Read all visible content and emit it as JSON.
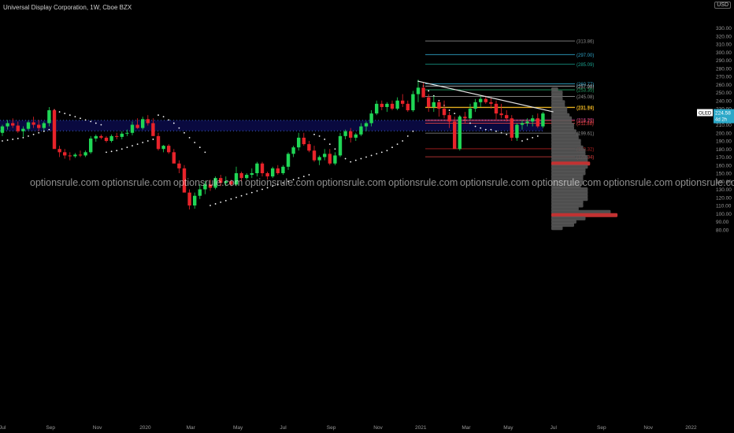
{
  "header": {
    "title": "Universal Display Corporation, 1W, Cboe BZX",
    "currency": "USD"
  },
  "ticker": {
    "symbol": "OLED",
    "price": "224.58",
    "countdown": "4d 2h"
  },
  "watermark": "optionsrule.com",
  "colors": {
    "up": "#1fd655",
    "down": "#e8232a",
    "sar": "#ffffff",
    "trendline": "#e6e6e6",
    "zone": "#0a0a4a",
    "axis_text": "#9a9a9a",
    "bg": "#000000",
    "volume_profile": "#5c5c5c",
    "poc": "#c23232"
  },
  "chart_data": {
    "type": "candlestick",
    "ylim": [
      80,
      320
    ],
    "y_ticks": [
      "330.00",
      "320.00",
      "310.00",
      "300.00",
      "290.00",
      "280.00",
      "270.00",
      "260.00",
      "250.00",
      "240.00",
      "230.00",
      "220.00",
      "210.00",
      "200.00",
      "190.00",
      "180.00",
      "170.00",
      "160.00",
      "150.00",
      "140.00",
      "130.00",
      "120.00",
      "110.00",
      "100.00",
      "90.00",
      "80.00"
    ],
    "x_labels": [
      {
        "label": "Jul",
        "week": 0
      },
      {
        "label": "Sep",
        "week": 9
      },
      {
        "label": "Nov",
        "week": 18
      },
      {
        "label": "2020",
        "week": 27
      },
      {
        "label": "Mar",
        "week": 36
      },
      {
        "label": "May",
        "week": 45
      },
      {
        "label": "Jul",
        "week": 54
      },
      {
        "label": "Sep",
        "week": 63
      },
      {
        "label": "Nov",
        "week": 72
      },
      {
        "label": "2021",
        "week": 80
      },
      {
        "label": "Mar",
        "week": 89
      },
      {
        "label": "May",
        "week": 97
      },
      {
        "label": "Jul",
        "week": 106
      },
      {
        "label": "Sep",
        "week": 115
      },
      {
        "label": "Nov",
        "week": 124
      },
      {
        "label": "2022",
        "week": 132
      }
    ],
    "candles": [
      [
        200,
        210,
        196,
        208
      ],
      [
        208,
        216,
        204,
        212
      ],
      [
        212,
        218,
        206,
        209
      ],
      [
        209,
        214,
        200,
        202
      ],
      [
        202,
        208,
        195,
        205
      ],
      [
        205,
        215,
        203,
        213
      ],
      [
        213,
        220,
        206,
        210
      ],
      [
        210,
        216,
        202,
        206
      ],
      [
        206,
        214,
        203,
        212
      ],
      [
        212,
        232,
        208,
        228
      ],
      [
        228,
        230,
        190,
        180
      ],
      [
        180,
        184,
        170,
        176
      ],
      [
        176,
        180,
        168,
        172
      ],
      [
        172,
        176,
        166,
        171
      ],
      [
        171,
        175,
        169,
        173
      ],
      [
        173,
        178,
        170,
        172
      ],
      [
        172,
        178,
        170,
        176
      ],
      [
        176,
        196,
        174,
        193
      ],
      [
        193,
        198,
        189,
        196
      ],
      [
        196,
        198,
        192,
        194
      ],
      [
        194,
        196,
        188,
        190
      ],
      [
        190,
        198,
        188,
        196
      ],
      [
        196,
        200,
        192,
        195
      ],
      [
        195,
        202,
        192,
        199
      ],
      [
        199,
        204,
        196,
        200
      ],
      [
        200,
        214,
        197,
        210
      ],
      [
        210,
        218,
        205,
        206
      ],
      [
        206,
        220,
        204,
        217
      ],
      [
        217,
        222,
        209,
        212
      ],
      [
        212,
        218,
        200,
        196
      ],
      [
        196,
        200,
        178,
        180
      ],
      [
        180,
        185,
        176,
        184
      ],
      [
        184,
        186,
        174,
        176
      ],
      [
        176,
        180,
        165,
        162
      ],
      [
        162,
        166,
        150,
        156
      ],
      [
        156,
        160,
        130,
        126
      ],
      [
        126,
        130,
        105,
        110
      ],
      [
        110,
        126,
        106,
        122
      ],
      [
        122,
        136,
        118,
        130
      ],
      [
        130,
        140,
        124,
        136
      ],
      [
        136,
        142,
        128,
        132
      ],
      [
        132,
        146,
        130,
        144
      ],
      [
        144,
        148,
        134,
        138
      ],
      [
        138,
        146,
        134,
        140
      ],
      [
        140,
        142,
        134,
        136
      ],
      [
        136,
        158,
        134,
        150
      ],
      [
        150,
        152,
        140,
        144
      ],
      [
        144,
        150,
        142,
        148
      ],
      [
        148,
        156,
        144,
        150
      ],
      [
        150,
        164,
        146,
        162
      ],
      [
        162,
        164,
        146,
        150
      ],
      [
        150,
        152,
        142,
        146
      ],
      [
        146,
        158,
        144,
        156
      ],
      [
        156,
        160,
        148,
        150
      ],
      [
        150,
        160,
        148,
        158
      ],
      [
        158,
        176,
        154,
        174
      ],
      [
        174,
        184,
        170,
        182
      ],
      [
        182,
        200,
        178,
        194
      ],
      [
        194,
        200,
        184,
        186
      ],
      [
        186,
        190,
        176,
        178
      ],
      [
        178,
        184,
        164,
        166
      ],
      [
        166,
        172,
        160,
        170
      ],
      [
        170,
        180,
        166,
        174
      ],
      [
        174,
        180,
        160,
        162
      ],
      [
        162,
        176,
        160,
        172
      ],
      [
        172,
        200,
        170,
        196
      ],
      [
        196,
        204,
        192,
        202
      ],
      [
        202,
        206,
        188,
        194
      ],
      [
        194,
        200,
        190,
        198
      ],
      [
        198,
        212,
        196,
        208
      ],
      [
        208,
        214,
        202,
        212
      ],
      [
        212,
        228,
        208,
        224
      ],
      [
        224,
        240,
        222,
        236
      ],
      [
        236,
        240,
        228,
        232
      ],
      [
        232,
        238,
        226,
        236
      ],
      [
        236,
        240,
        228,
        230
      ],
      [
        230,
        244,
        228,
        240
      ],
      [
        240,
        248,
        232,
        236
      ],
      [
        236,
        240,
        226,
        228
      ],
      [
        228,
        252,
        226,
        248
      ],
      [
        248,
        266,
        238,
        256
      ],
      [
        256,
        262,
        246,
        244
      ],
      [
        244,
        248,
        226,
        232
      ],
      [
        232,
        246,
        226,
        238
      ],
      [
        238,
        240,
        220,
        230
      ],
      [
        230,
        240,
        218,
        222
      ],
      [
        222,
        226,
        206,
        214
      ],
      [
        214,
        220,
        182,
        180
      ],
      [
        180,
        222,
        178,
        220
      ],
      [
        220,
        226,
        212,
        218
      ],
      [
        218,
        236,
        216,
        230
      ],
      [
        230,
        242,
        226,
        238
      ],
      [
        238,
        246,
        232,
        242
      ],
      [
        242,
        246,
        236,
        238
      ],
      [
        238,
        244,
        230,
        236
      ],
      [
        236,
        240,
        216,
        224
      ],
      [
        224,
        236,
        218,
        222
      ],
      [
        222,
        228,
        214,
        218
      ],
      [
        218,
        222,
        190,
        194
      ],
      [
        194,
        212,
        190,
        210
      ],
      [
        210,
        216,
        204,
        212
      ],
      [
        212,
        218,
        208,
        214
      ],
      [
        214,
        222,
        208,
        218
      ],
      [
        218,
        224,
        206,
        208
      ],
      [
        208,
        226,
        206,
        224
      ]
    ],
    "sar": [
      190,
      191,
      192,
      193,
      194,
      196,
      198,
      200,
      202,
      204,
      228,
      226,
      224,
      222,
      220,
      218,
      216,
      214,
      212,
      210,
      176,
      177,
      178,
      180,
      182,
      184,
      186,
      188,
      190,
      192,
      222,
      220,
      216,
      212,
      206,
      200,
      194,
      188,
      182,
      176,
      110,
      112,
      114,
      116,
      118,
      120,
      122,
      124,
      126,
      128,
      130,
      132,
      134,
      136,
      138,
      140,
      142,
      144,
      146,
      148,
      198,
      196,
      192,
      186,
      180,
      174,
      168,
      164,
      166,
      168,
      170,
      172,
      174,
      176,
      178,
      182,
      186,
      190,
      196,
      202,
      264,
      258,
      252,
      246,
      240,
      234,
      228,
      224,
      220,
      216,
      212,
      208,
      206,
      204,
      204,
      202,
      200,
      198,
      196,
      194,
      190,
      192,
      194,
      196
    ],
    "fib_levels": [
      {
        "label": "(313.86)",
        "value": 313.86,
        "color": "#888888"
      },
      {
        "label": "(297.00)",
        "value": 297.0,
        "color": "#2fa4c8"
      },
      {
        "label": "(285.09)",
        "value": 285.09,
        "color": "#1aa08e"
      },
      {
        "label": "(260.77)",
        "value": 260.77,
        "color": "#2fa4c8"
      },
      {
        "label": "(257.98)",
        "value": 257.98,
        "color": "#c0c0c0"
      },
      {
        "label": "(253.35)",
        "value": 253.35,
        "color": "#25a86a"
      },
      {
        "label": "(245.08)",
        "value": 245.08,
        "color": "#909090"
      },
      {
        "label": "(231.84)",
        "value": 231.84,
        "color": "#e0c020"
      },
      {
        "label": "(231.19)",
        "value": 231.19,
        "color": "#e6a020"
      },
      {
        "label": "(216.20)",
        "value": 216.2,
        "color": "#c04090"
      },
      {
        "label": "(214.73)",
        "value": 214.73,
        "color": "#d04040"
      },
      {
        "label": "(211.88)",
        "value": 211.88,
        "color": "#e04040"
      },
      {
        "label": "(199.61)",
        "value": 199.61,
        "color": "#909090"
      },
      {
        "label": "(180.32)",
        "value": 180.32,
        "color": "#b02020"
      },
      {
        "label": "(170.34)",
        "value": 170.34,
        "color": "#e04040"
      }
    ],
    "zone": [
      202.5,
      215.5
    ],
    "trendline": {
      "from": [
        80,
        264
      ],
      "to": [
        106,
        226
      ]
    },
    "volume_profile": [
      {
        "price": 254,
        "w": 3
      },
      {
        "price": 250,
        "w": 5
      },
      {
        "price": 246,
        "w": 5
      },
      {
        "price": 242,
        "w": 5
      },
      {
        "price": 238,
        "w": 6
      },
      {
        "price": 234,
        "w": 6
      },
      {
        "price": 230,
        "w": 7
      },
      {
        "price": 226,
        "w": 7
      },
      {
        "price": 222,
        "w": 8
      },
      {
        "price": 218,
        "w": 9
      },
      {
        "price": 214,
        "w": 9
      },
      {
        "price": 210,
        "w": 10
      },
      {
        "price": 206,
        "w": 10
      },
      {
        "price": 202,
        "w": 11
      },
      {
        "price": 198,
        "w": 12
      },
      {
        "price": 194,
        "w": 12
      },
      {
        "price": 190,
        "w": 13
      },
      {
        "price": 186,
        "w": 13
      },
      {
        "price": 182,
        "w": 14
      },
      {
        "price": 178,
        "w": 15
      },
      {
        "price": 174,
        "w": 15
      },
      {
        "price": 170,
        "w": 16
      },
      {
        "price": 166,
        "w": 16
      },
      {
        "price": 162,
        "w": 17,
        "poc": true
      },
      {
        "price": 158,
        "w": 16
      },
      {
        "price": 154,
        "w": 15
      },
      {
        "price": 150,
        "w": 15
      },
      {
        "price": 146,
        "w": 14
      },
      {
        "price": 142,
        "w": 14
      },
      {
        "price": 138,
        "w": 14
      },
      {
        "price": 134,
        "w": 13
      },
      {
        "price": 130,
        "w": 16
      },
      {
        "price": 126,
        "w": 16
      },
      {
        "price": 122,
        "w": 16
      },
      {
        "price": 118,
        "w": 16
      },
      {
        "price": 114,
        "w": 14
      },
      {
        "price": 110,
        "w": 14
      },
      {
        "price": 106,
        "w": 12
      },
      {
        "price": 102,
        "w": 26
      },
      {
        "price": 98,
        "w": 29,
        "poc": true
      },
      {
        "price": 94,
        "w": 15
      },
      {
        "price": 90,
        "w": 11
      },
      {
        "price": 86,
        "w": 10
      },
      {
        "price": 82,
        "w": 5
      }
    ]
  }
}
